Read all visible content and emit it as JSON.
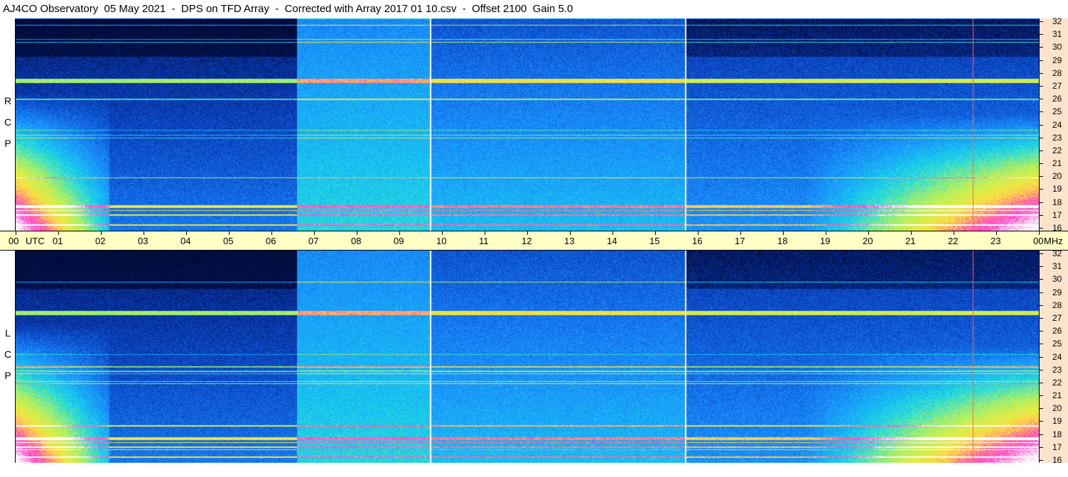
{
  "title": "AJ4CO Observatory  05 May 2021  -  DPS on TFD Array  -  Corrected with Array 2017 01 10.csv  -  Offset 2100  Gain 5.0",
  "panels": [
    {
      "id": "rcp",
      "letters": [
        "R",
        "C",
        "P"
      ]
    },
    {
      "id": "lcp",
      "letters": [
        "L",
        "C",
        "P"
      ]
    }
  ],
  "utc_axis": {
    "labels": [
      "00",
      "UTC",
      "01",
      "02",
      "03",
      "04",
      "05",
      "06",
      "07",
      "08",
      "09",
      "10",
      "11",
      "12",
      "13",
      "14",
      "15",
      "16",
      "17",
      "18",
      "19",
      "20",
      "21",
      "22",
      "23",
      "00",
      "MHz"
    ]
  },
  "freq_axis": {
    "labels": [
      "32",
      "31",
      "30",
      "29",
      "28",
      "27",
      "26",
      "25",
      "24",
      "23",
      "22",
      "21",
      "20",
      "19",
      "18",
      "17",
      "16"
    ]
  },
  "chart_data": {
    "type": "heatmap",
    "title": "AJ4CO Observatory  05 May 2021  -  DPS on TFD Array  -  Corrected with Array 2017 01 10.csv  -  Offset 2100  Gain 5.0",
    "xlabel": "UTC",
    "ylabel": "MHz",
    "x_range": [
      "00",
      "00"
    ],
    "x_ticks": [
      "00",
      "01",
      "02",
      "03",
      "04",
      "05",
      "06",
      "07",
      "08",
      "09",
      "10",
      "11",
      "12",
      "13",
      "14",
      "15",
      "16",
      "17",
      "18",
      "19",
      "20",
      "21",
      "22",
      "23",
      "00"
    ],
    "y_range": [
      16,
      32
    ],
    "y_ticks": [
      32,
      31,
      30,
      29,
      28,
      27,
      26,
      25,
      24,
      23,
      22,
      21,
      20,
      19,
      18,
      17,
      16
    ],
    "panels": [
      "RCP",
      "LCP"
    ],
    "colormap": [
      "#000b3a",
      "#0a3fbf",
      "#1a8cff",
      "#19d9e8",
      "#b7f25c",
      "#ffe43a",
      "#ff3ac8",
      "#ffffff"
    ],
    "grid": false
  }
}
